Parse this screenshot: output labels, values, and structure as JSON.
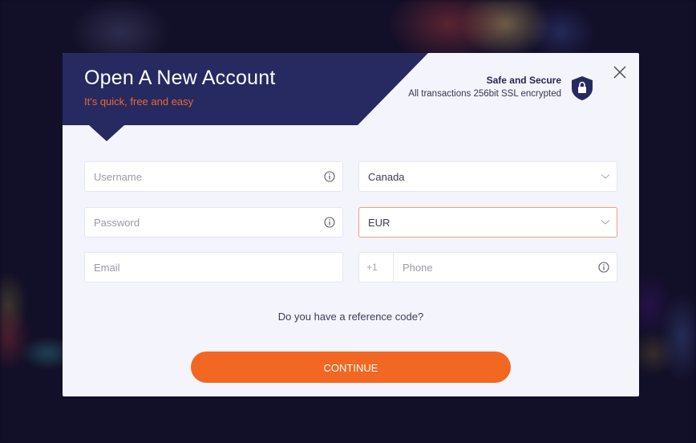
{
  "modal": {
    "title": "Open A New Account",
    "subtitle": "It's quick, free and easy",
    "security": {
      "title": "Safe and Secure",
      "subtitle": "All transactions 256bit SSL encrypted",
      "icon": "shield-lock-icon"
    },
    "close_icon": "close-icon"
  },
  "form": {
    "username": {
      "placeholder": "Username",
      "value": ""
    },
    "password": {
      "placeholder": "Password",
      "value": ""
    },
    "email": {
      "placeholder": "Email",
      "value": ""
    },
    "country": {
      "selected": "Canada"
    },
    "currency": {
      "selected": "EUR"
    },
    "phone": {
      "prefix": "+1",
      "placeholder": "Phone",
      "value": ""
    },
    "reference_link": "Do you have a reference code?",
    "continue_label": "CONTINUE"
  },
  "colors": {
    "header": "#262a60",
    "accent": "#f26722",
    "modal_bg": "#f4f4fc"
  }
}
